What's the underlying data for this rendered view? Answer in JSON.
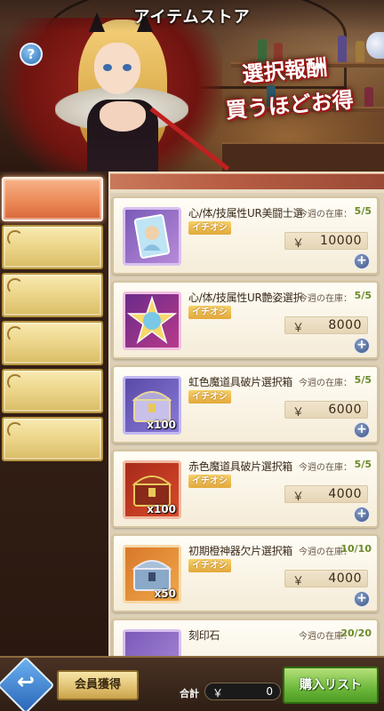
{
  "header": {
    "title": "アイテムストア",
    "help_label": "?",
    "promo_line1": "選択報酬",
    "promo_line2": "買うほどお得"
  },
  "tabs": [
    {
      "label": "",
      "active": true
    },
    {
      "label": "",
      "active": false
    },
    {
      "label": "",
      "active": false
    },
    {
      "label": "",
      "active": false
    },
    {
      "label": "",
      "active": false
    },
    {
      "label": "",
      "active": false
    }
  ],
  "items": [
    {
      "name": "心/体/技属性UR美闘士選択券",
      "stock_label": "今週の在庫：",
      "stock": "5/5",
      "badge": "イチオシ",
      "currency": "￥",
      "price": "10000",
      "qty": "",
      "icon": "ur-fighter-ticket-icon"
    },
    {
      "name": "心/体/技属性UR艶姿選択券",
      "stock_label": "今週の在庫：",
      "stock": "5/5",
      "badge": "イチオシ",
      "currency": "￥",
      "price": "8000",
      "qty": "",
      "icon": "ur-costume-ticket-icon"
    },
    {
      "name": "虹色魔道具破片選択箱",
      "stock_label": "今週の在庫：",
      "stock": "5/5",
      "badge": "イチオシ",
      "currency": "￥",
      "price": "6000",
      "qty": "x100",
      "icon": "rainbow-chest-icon"
    },
    {
      "name": "赤色魔道具破片選択箱",
      "stock_label": "今週の在庫：",
      "stock": "5/5",
      "badge": "イチオシ",
      "currency": "￥",
      "price": "4000",
      "qty": "x100",
      "icon": "red-chest-icon"
    },
    {
      "name": "初期橙神器欠片選択箱",
      "stock_label": "今週の在庫：",
      "stock": "10/10",
      "badge": "イチオシ",
      "currency": "￥",
      "price": "4000",
      "qty": "x50",
      "icon": "orange-artifact-chest-icon"
    },
    {
      "name": "刻印石",
      "stock_label": "今週の在庫：",
      "stock": "20/20",
      "badge": "",
      "currency": "",
      "price": "",
      "qty": "",
      "icon": "seal-stone-icon"
    }
  ],
  "footer": {
    "back_icon": "↩",
    "member_label": "会員獲得",
    "total_label": "合計",
    "currency": "￥",
    "total_value": "0",
    "buy_label": "購入リスト"
  },
  "colors": {
    "accent_orange": "#ec8a58",
    "tab_gold": "#ecd58a",
    "stock_green": "#6b8a2a",
    "buy_green": "#6cb83a",
    "badge_gold": "#e2a83a"
  }
}
